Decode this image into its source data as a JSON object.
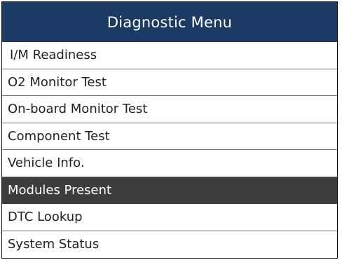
{
  "header": {
    "title": "Diagnostic Menu"
  },
  "menu": {
    "items": [
      {
        "label": "I/M Readiness"
      },
      {
        "label": "O2 Monitor Test"
      },
      {
        "label": "On-board Monitor Test"
      },
      {
        "label": "Component Test"
      },
      {
        "label": "Vehicle Info."
      },
      {
        "label": "Modules Present",
        "selected": true
      },
      {
        "label": "DTC Lookup"
      },
      {
        "label": "System Status"
      }
    ]
  },
  "colors": {
    "header_bg": "#1b3a64",
    "selected_bg": "#3d3d3d",
    "divider": "#6f6f6f"
  }
}
